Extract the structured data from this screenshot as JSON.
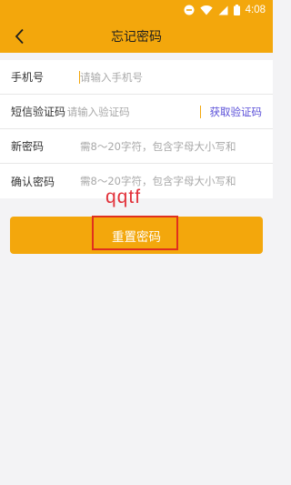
{
  "status_bar": {
    "time": "4:08",
    "icons": [
      "minus-circle-icon",
      "wifi-icon",
      "signal-icon",
      "battery-icon"
    ]
  },
  "nav": {
    "title": "忘记密码",
    "back_icon": "chevron-left-icon"
  },
  "form": {
    "phone": {
      "label": "手机号",
      "placeholder": "请输入手机号",
      "value": ""
    },
    "sms_code": {
      "label": "短信验证码",
      "placeholder": "请输入验证码",
      "value": "",
      "get_code_label": "获取验证码"
    },
    "new_password": {
      "label": "新密码",
      "placeholder": "需8～20字符，包含字母大小写和",
      "value": ""
    },
    "confirm_password": {
      "label": "确认密码",
      "placeholder": "需8～20字符，包含字母大小写和",
      "value": ""
    }
  },
  "actions": {
    "reset_label": "重置密码"
  },
  "overlay": {
    "watermark_text": "qqtf",
    "highlight_color": "#e0301e"
  },
  "colors": {
    "brand": "#f3a70c",
    "link": "#5a4fd8",
    "background": "#f3f3f5"
  }
}
